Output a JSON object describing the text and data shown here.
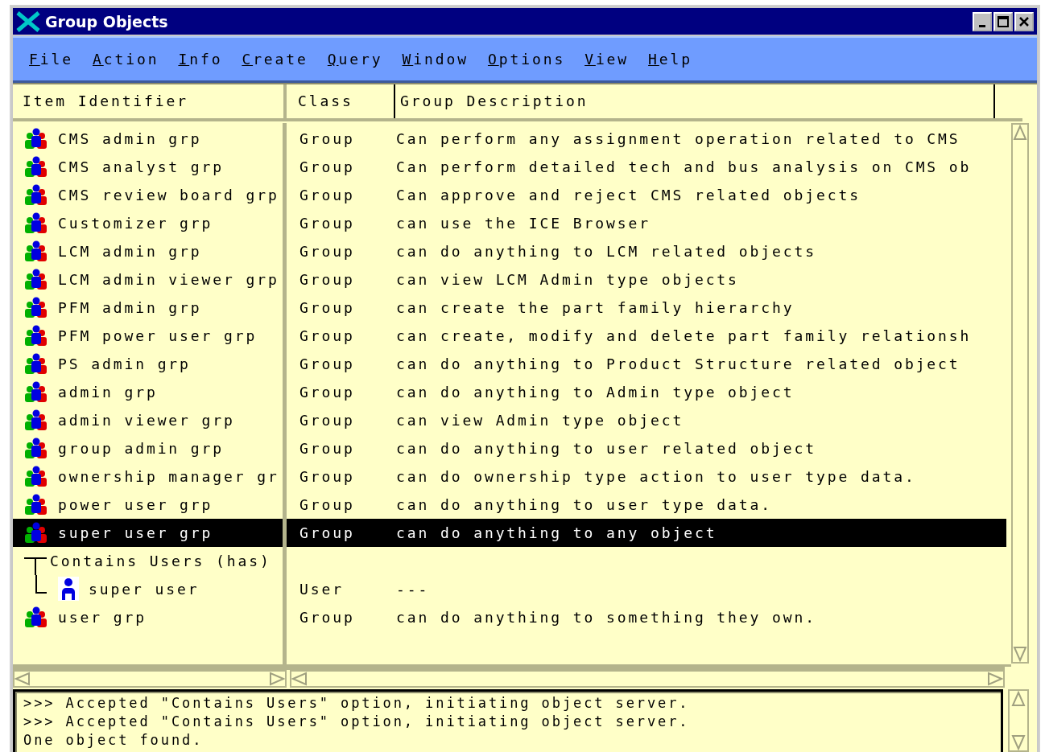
{
  "window": {
    "title": "Group Objects"
  },
  "menu": [
    {
      "label": "File"
    },
    {
      "label": "Action"
    },
    {
      "label": "Info"
    },
    {
      "label": "Create"
    },
    {
      "label": "Query"
    },
    {
      "label": "Window"
    },
    {
      "label": "Options"
    },
    {
      "label": "View"
    },
    {
      "label": "Help"
    }
  ],
  "table": {
    "columns": [
      "Item Identifier",
      "Class",
      "Group Description"
    ],
    "rows": [
      {
        "kind": "group",
        "name": "CMS admin grp",
        "class": "Group",
        "description": "Can perform any assignment operation related to CMS",
        "selected": false
      },
      {
        "kind": "group",
        "name": "CMS analyst grp",
        "class": "Group",
        "description": "Can perform detailed tech and bus analysis on CMS ob",
        "selected": false
      },
      {
        "kind": "group",
        "name": "CMS review board grp",
        "class": "Group",
        "description": "Can approve and reject CMS related objects",
        "selected": false
      },
      {
        "kind": "group",
        "name": "Customizer grp",
        "class": "Group",
        "description": "can use the ICE Browser",
        "selected": false
      },
      {
        "kind": "group",
        "name": "LCM admin grp",
        "class": "Group",
        "description": "can do anything to LCM related objects",
        "selected": false
      },
      {
        "kind": "group",
        "name": "LCM admin viewer grp",
        "class": "Group",
        "description": "can view LCM Admin type objects",
        "selected": false
      },
      {
        "kind": "group",
        "name": "PFM admin grp",
        "class": "Group",
        "description": "can create the part family hierarchy",
        "selected": false
      },
      {
        "kind": "group",
        "name": "PFM power user grp",
        "class": "Group",
        "description": "can create, modify and delete part family relationsh",
        "selected": false
      },
      {
        "kind": "group",
        "name": "PS admin grp",
        "class": "Group",
        "description": "can do anything to Product Structure related object",
        "selected": false
      },
      {
        "kind": "group",
        "name": "admin grp",
        "class": "Group",
        "description": "can do anything to Admin type object",
        "selected": false
      },
      {
        "kind": "group",
        "name": "admin viewer grp",
        "class": "Group",
        "description": "can view Admin type object",
        "selected": false
      },
      {
        "kind": "group",
        "name": "group admin grp",
        "class": "Group",
        "description": "can do anything to user related object",
        "selected": false
      },
      {
        "kind": "group",
        "name": "ownership manager gr",
        "class": "Group",
        "description": "can do ownership type action to user type data.",
        "selected": false
      },
      {
        "kind": "group",
        "name": "power user grp",
        "class": "Group",
        "description": "can do anything to user type data.",
        "selected": false
      },
      {
        "kind": "group",
        "name": "super user grp",
        "class": "Group",
        "description": "can do anything to any object",
        "selected": true,
        "children": [
          {
            "kind": "relation",
            "name": "Contains Users (has)",
            "children": [
              {
                "kind": "user",
                "name": "super user",
                "class": "User",
                "description": "---",
                "selected": false
              }
            ]
          }
        ]
      },
      {
        "kind": "group",
        "name": "user grp",
        "class": "Group",
        "description": "can do anything to something they own.",
        "selected": false
      }
    ]
  },
  "messages": [
    ">>> Accepted \"Contains Users\" option, initiating object server.",
    ">>> Accepted \"Contains Users\" option, initiating object server.",
    "One object found."
  ]
}
